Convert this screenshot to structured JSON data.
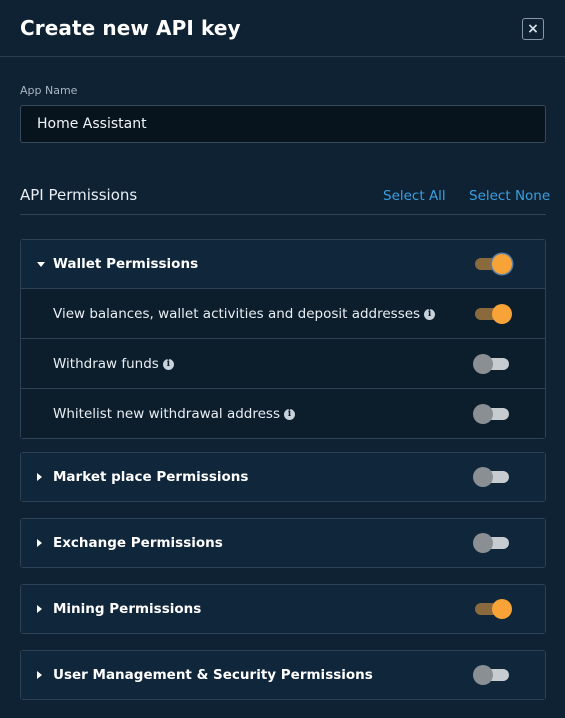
{
  "dialog": {
    "title": "Create new API key",
    "close_label": "×"
  },
  "app_name": {
    "label": "App Name",
    "value": "Home Assistant"
  },
  "permissions": {
    "title": "API Permissions",
    "select_all": "Select All",
    "select_none": "Select None"
  },
  "groups": [
    {
      "label": "Wallet Permissions",
      "expanded": true,
      "enabled": true,
      "items": [
        {
          "label": "View balances, wallet activities and deposit addresses",
          "enabled": true
        },
        {
          "label": "Withdraw funds",
          "enabled": false
        },
        {
          "label": "Whitelist new withdrawal address",
          "enabled": false
        }
      ]
    },
    {
      "label": "Market place Permissions",
      "expanded": false,
      "enabled": false
    },
    {
      "label": "Exchange Permissions",
      "expanded": false,
      "enabled": false
    },
    {
      "label": "Mining Permissions",
      "expanded": false,
      "enabled": true
    },
    {
      "label": "User Management & Security Permissions",
      "expanded": false,
      "enabled": false
    }
  ],
  "icons": {
    "info": "info-icon",
    "expanded": "caret-down-icon",
    "collapsed": "caret-right-icon",
    "close": "close-icon"
  },
  "colors": {
    "background": "#0f2233",
    "toggle_on": "#f7a338",
    "toggle_off": "#8a8f94",
    "link": "#3a9fe0"
  }
}
